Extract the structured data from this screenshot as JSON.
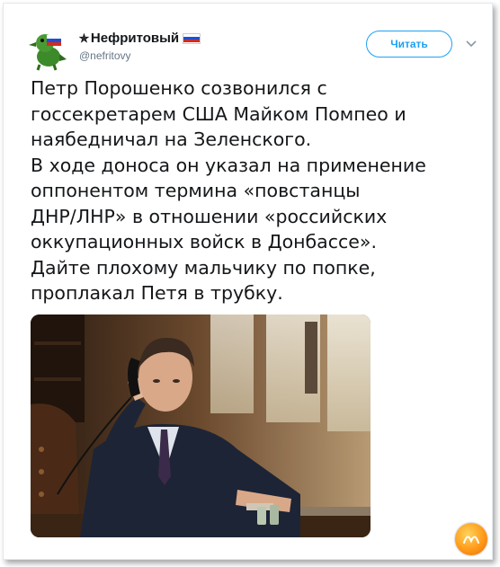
{
  "tweet": {
    "user": {
      "star": "✯",
      "name": "Нефритовый",
      "handle": "@nefritovy"
    },
    "follow_label": "Читать",
    "text_lines": [
      "Петр Порошенко созвонился с",
      "госсекретарем США Майком Помпео и",
      "наябедничал на Зеленского.",
      "В ходе доноса он указал на применение",
      "оппонентом термина «повстанцы",
      "ДНР/ЛНР» в отношении «российских",
      "оккупационных войск в Донбассе».",
      "Дайте плохому мальчику по попке,",
      "проплакал Петя в трубку."
    ]
  },
  "colors": {
    "accent": "#1da1f2",
    "text": "#14171a",
    "muted": "#657786"
  },
  "icons": {
    "avatar": "green-bird-with-russian-flag",
    "flag": "russian-flag-icon",
    "menu": "chevron-down-icon",
    "watermark": "orange-watermark-badge"
  }
}
